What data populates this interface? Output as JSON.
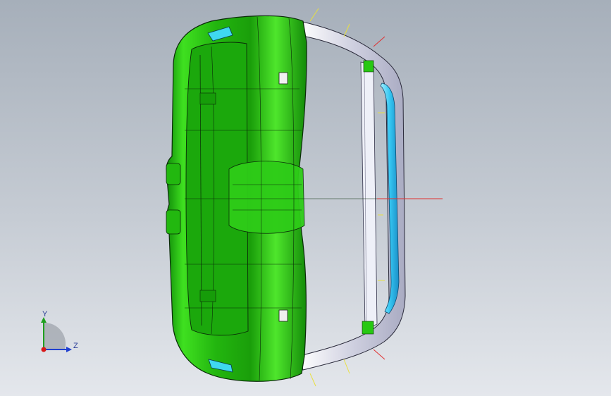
{
  "viewport": {
    "background_top": "#a6afba",
    "background_bottom": "#e4e7ec"
  },
  "model": {
    "body_color": "#22c40f",
    "body_highlight": "#7cf55a",
    "body_shadow": "#0f7d08",
    "frame_color": "#dcdde8",
    "glass_color": "#36c6f2",
    "edge_color": "#0a2a08"
  },
  "triad": {
    "x_color": "#d81818",
    "y_color": "#1ea01e",
    "z_color": "#2040d0",
    "y_label": "Y",
    "z_label": "Z"
  }
}
